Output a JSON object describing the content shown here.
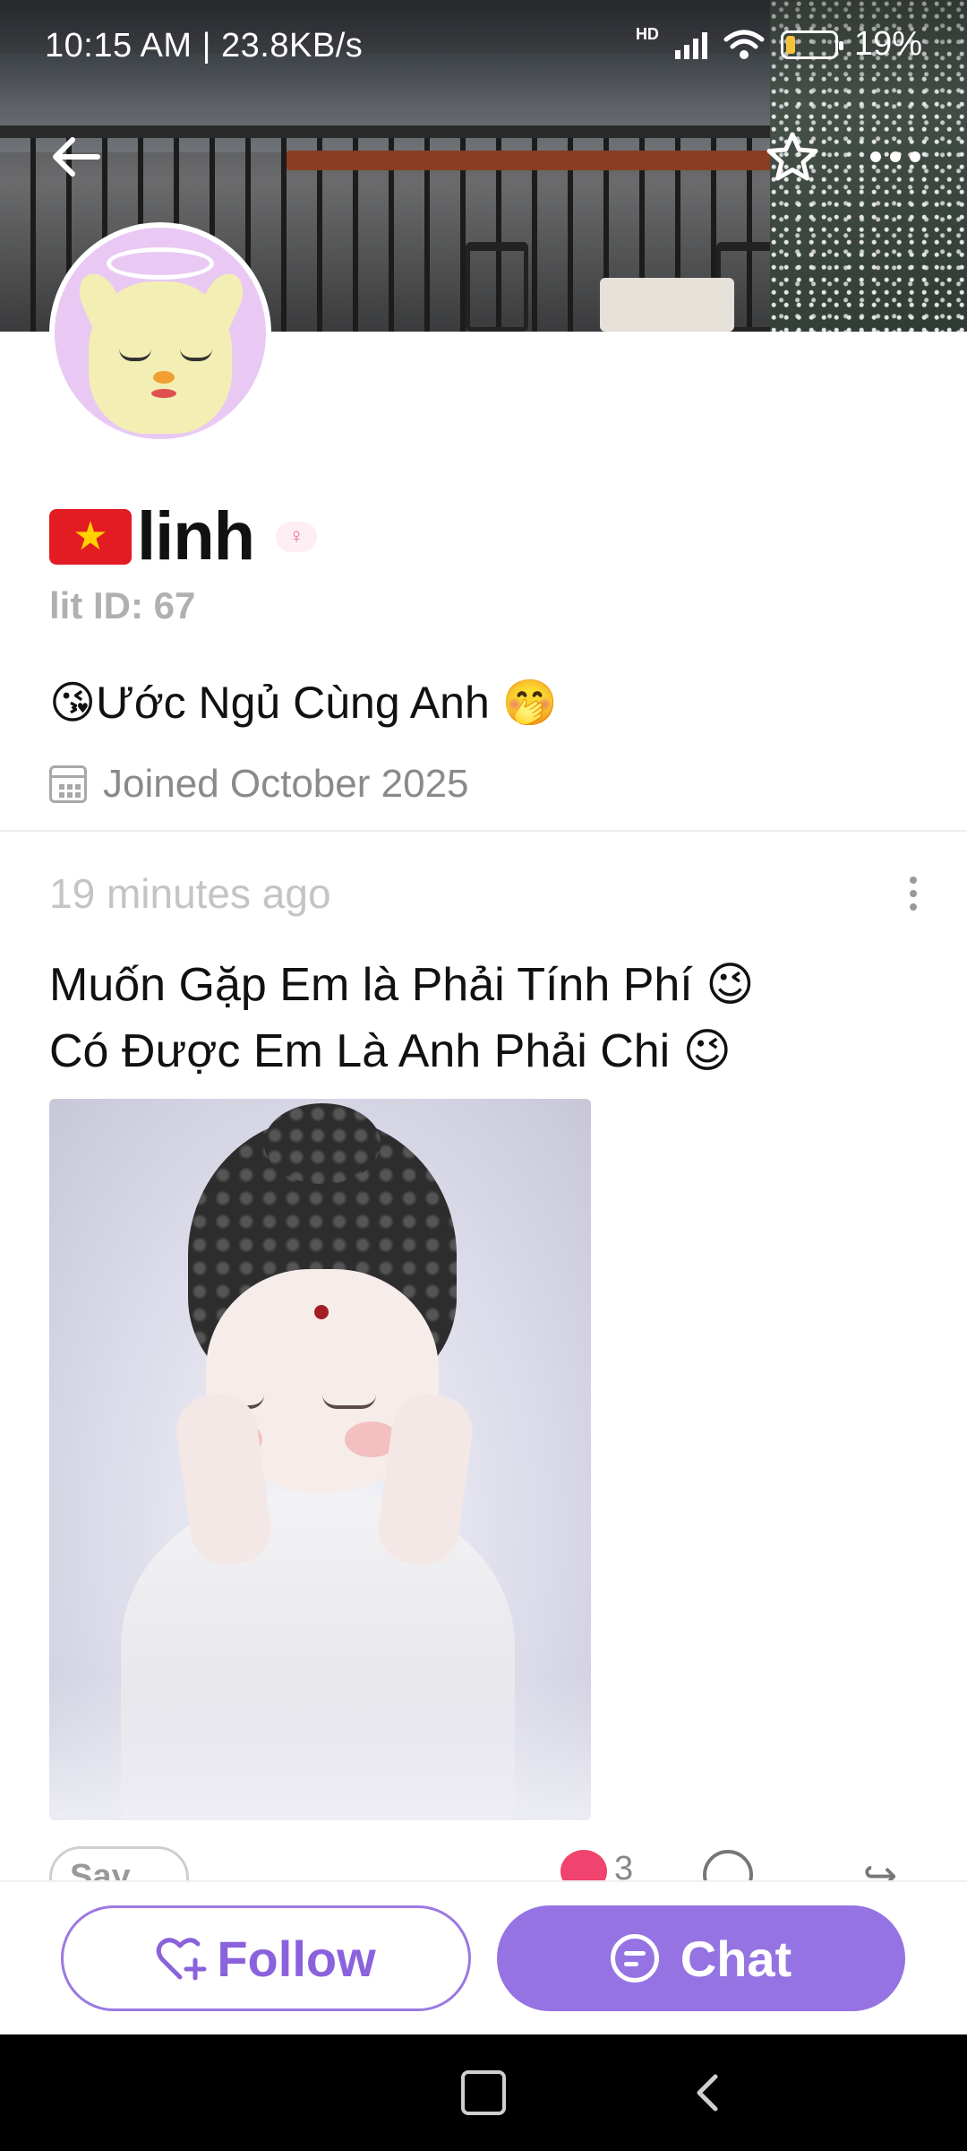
{
  "status_bar": {
    "time": "10:15 AM | 23.8KB/s",
    "network": "HD",
    "battery": "19%",
    "battery_level": 0.19
  },
  "header": {
    "back_icon": "arrow-left-icon",
    "favorite_icon": "star-icon",
    "more_icon": "more-horizontal-icon"
  },
  "profile": {
    "flag": "★",
    "name": "linh",
    "gender_icon": "female-icon",
    "lit_id": "lit ID: 67",
    "bio": "😘Ước Ngủ Cùng Anh 🤭",
    "joined": "Joined October 2025"
  },
  "post": {
    "time": "19 minutes ago",
    "line1": "Muốn Gặp Em là Phải Tính Phí 😉",
    "line2": "Có Được Em Là Anh Phải Chi 😉",
    "say_hi": "Say Hi",
    "like_count": "3"
  },
  "actions": {
    "follow": "Follow",
    "chat": "Chat"
  },
  "colors": {
    "accent": "#9573e3",
    "follow_border": "#9b79e2",
    "like": "#f0436d"
  }
}
